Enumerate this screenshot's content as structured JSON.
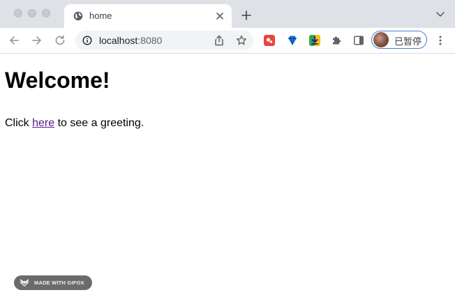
{
  "browser": {
    "tab": {
      "title": "home"
    },
    "address_bar": {
      "host": "localhost",
      "port": ":8080"
    },
    "profile": {
      "label": "已暂停"
    }
  },
  "page": {
    "heading": "Welcome!",
    "paragraph": {
      "before": "Click ",
      "link": "here",
      "after": " to see a greeting."
    }
  },
  "watermark": {
    "text": "MADE WITH GIFOX"
  },
  "colors": {
    "visited_link": "#551a8b",
    "tabstrip": "#dee1e6",
    "profile_ring": "#4a7fd4"
  },
  "icons": [
    "globe-icon",
    "close-icon",
    "plus-icon",
    "chevron-down-icon",
    "back-icon",
    "forward-icon",
    "reload-icon",
    "info-icon",
    "share-icon",
    "star-icon",
    "extension-red-icon",
    "extension-diamond-icon",
    "extension-download-icon",
    "puzzle-icon",
    "side-panel-icon",
    "more-icon"
  ]
}
